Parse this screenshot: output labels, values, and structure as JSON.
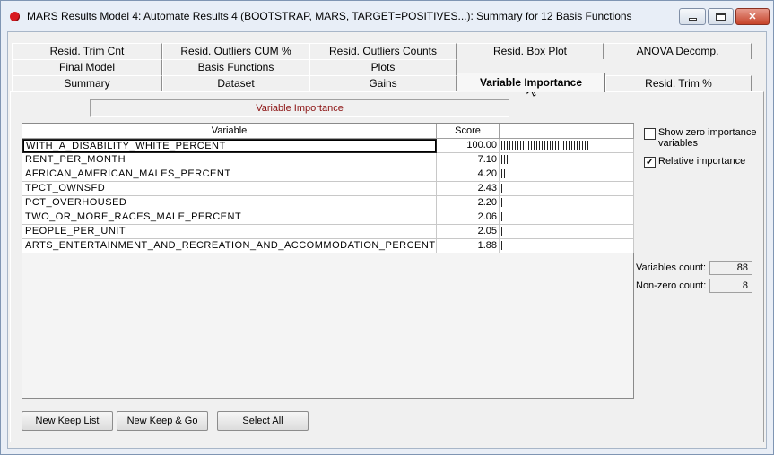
{
  "window": {
    "title": "MARS Results Model 4: Automate Results 4 (BOOTSTRAP, MARS, TARGET=POSITIVES...): Summary for 12 Basis Functions",
    "close_label": "✕"
  },
  "tabs": {
    "row1": [
      "Resid. Trim Cnt",
      "Resid. Outliers CUM %",
      "Resid. Outliers Counts",
      "Resid. Box Plot",
      "ANOVA Decomp."
    ],
    "row2": [
      "Final Model",
      "Basis Functions",
      "Plots"
    ],
    "row3": [
      "Summary",
      "Dataset",
      "Gains",
      "Variable Importance",
      "Resid. Trim %"
    ],
    "selected": "Variable Importance"
  },
  "panel": {
    "section_label": "Variable Importance",
    "columns": [
      "Variable",
      "Score"
    ],
    "rows": [
      {
        "variable": "WITH_A_DISABILITY_WHITE_PERCENT",
        "score": "100.00",
        "bar": 1.0
      },
      {
        "variable": "RENT_PER_MONTH",
        "score": "7.10",
        "bar": 0.071
      },
      {
        "variable": "AFRICAN_AMERICAN_MALES_PERCENT",
        "score": "4.20",
        "bar": 0.042
      },
      {
        "variable": "TPCT_OWNSFD",
        "score": "2.43",
        "bar": 0.0243
      },
      {
        "variable": "PCT_OVERHOUSED",
        "score": "2.20",
        "bar": 0.022
      },
      {
        "variable": "TWO_OR_MORE_RACES_MALE_PERCENT",
        "score": "2.06",
        "bar": 0.0206
      },
      {
        "variable": "PEOPLE_PER_UNIT",
        "score": "2.05",
        "bar": 0.0205
      },
      {
        "variable": "ARTS_ENTERTAINMENT_AND_RECREATION_AND_ACCOMMODATION_PERCENT",
        "score": "1.88",
        "bar": 0.0188
      }
    ],
    "show_zero_label": "Show zero importance variables",
    "show_zero_checked": false,
    "relative_label": "Relative importance",
    "relative_checked": true,
    "variables_count_label": "Variables count:",
    "variables_count": "88",
    "nonzero_count_label": "Non-zero count:",
    "nonzero_count": "8",
    "buttons": {
      "new_keep_list": "New Keep List",
      "new_keep_go": "New Keep & Go",
      "select_all": "Select All"
    }
  }
}
